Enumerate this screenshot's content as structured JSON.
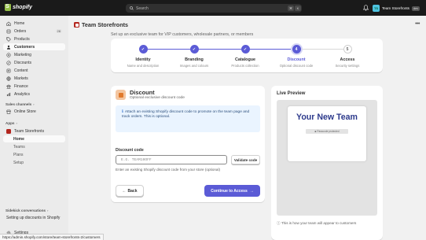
{
  "topbar": {
    "brand": "shopify",
    "search_placeholder": "Search",
    "shortcut_mod": "⌘",
    "shortcut_key": "K",
    "store_initials": "TS",
    "store_name": "Team Storefronts",
    "store_badge": "dev"
  },
  "sidebar": {
    "items": [
      {
        "label": "Home",
        "icon": "home-icon"
      },
      {
        "label": "Orders",
        "icon": "orders-icon",
        "count": "28"
      },
      {
        "label": "Products",
        "icon": "tag-icon"
      },
      {
        "label": "Customers",
        "icon": "person-icon"
      },
      {
        "label": "Marketing",
        "icon": "target-icon"
      },
      {
        "label": "Discounts",
        "icon": "discount-icon"
      },
      {
        "label": "Content",
        "icon": "content-icon"
      },
      {
        "label": "Markets",
        "icon": "globe-icon"
      },
      {
        "label": "Finance",
        "icon": "bank-icon"
      },
      {
        "label": "Analytics",
        "icon": "chart-icon"
      }
    ],
    "sales_channels_label": "Sales channels",
    "online_store_label": "Online Store",
    "apps_label": "Apps",
    "app_name": "Team Storefronts",
    "app_subitems": [
      "Home",
      "Teams",
      "Plans",
      "Setup"
    ],
    "sidekick_label": "Sidekick conversations",
    "sidekick_item": "Setting up discounts in Shopify",
    "settings_label": "Settings"
  },
  "page": {
    "title": "Team Storefronts",
    "intro": "Set up an exclusive team for VIP customers, wholesale partners, or members"
  },
  "steps": [
    {
      "title": "Identity",
      "sub": "Name and description",
      "state": "done",
      "mark": "✓"
    },
    {
      "title": "Branding",
      "sub": "Images and colours",
      "state": "done",
      "mark": "✓"
    },
    {
      "title": "Catalogue",
      "sub": "Products collection",
      "state": "done",
      "mark": "✓"
    },
    {
      "title": "Discount",
      "sub": "Optional discount code",
      "state": "current",
      "mark": "4"
    },
    {
      "title": "Access",
      "sub": "Security settings",
      "state": "todo",
      "mark": "5"
    }
  ],
  "form": {
    "title": "Discount",
    "subtitle": "Optional exclusive discount code",
    "info": "Attach an existing Shopify discount code to promote on the team page and track orders. This is optional.",
    "field_label": "Discount code",
    "placeholder": "E.G. TEAM10OFF",
    "validate_label": "Validate code",
    "help": "Enter an existing Shopify discount code from your store (optional)",
    "back_label": "Back",
    "continue_label": "Continue to Access"
  },
  "preview": {
    "title": "Live Preview",
    "heading": "Your New Team",
    "pw_label": "Passcode protected",
    "note": "This is how your team will appear to customers"
  },
  "status_url": "https://admin.shopify.com/store/team-storefronts-2/customers",
  "colors": {
    "accent": "#5b5bd6",
    "topbar": "#1a1a1a",
    "brand_green": "#95bf47"
  }
}
